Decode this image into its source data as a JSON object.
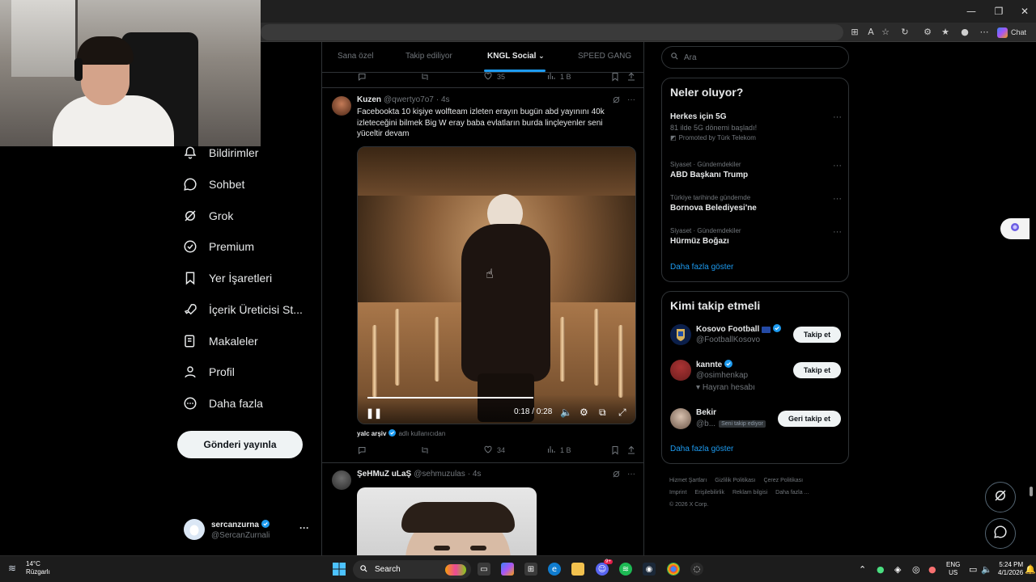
{
  "tabs": [
    {
      "label": "Sana özel"
    },
    {
      "label": "Takip ediliyor"
    },
    {
      "label": "KNGL Social"
    },
    {
      "label": "SPEED GANG"
    }
  ],
  "nav": {
    "items": [
      {
        "label": "Bildirimler",
        "icon": "bell-icon"
      },
      {
        "label": "Sohbet",
        "icon": "chat-icon"
      },
      {
        "label": "Grok",
        "icon": "grok-icon"
      },
      {
        "label": "Premium",
        "icon": "premium-icon"
      },
      {
        "label": "Yer İşaretleri",
        "icon": "bookmark-icon"
      },
      {
        "label": "İçerik Üreticisi St...",
        "icon": "rocket-icon"
      },
      {
        "label": "Makaleler",
        "icon": "article-icon"
      },
      {
        "label": "Profil",
        "icon": "person-icon"
      },
      {
        "label": "Daha fazla",
        "icon": "more-circle-icon"
      }
    ],
    "post_button": "Gönderi yayınla"
  },
  "account": {
    "name": "sercanzurna",
    "handle": "@SercanZurnali"
  },
  "top_actions": {
    "likes": "35",
    "views": "1 B"
  },
  "tweet1": {
    "name": "Kuzen",
    "handle": "@qwertyo7o7",
    "time": "· 4s",
    "text": "Facebookta 10 kişiye wolfteam izleten erayın bugün abd yayınını 40k izleteceğini bilmek Big W eray baba evlatların burda linçleyenler seni yüceltir devam",
    "video_time": "0:18 / 0:28",
    "video_progress": 0.64,
    "attribution_name": "yalc arşiv",
    "attribution_suffix": "adlı kullanıcıdan",
    "likes": "34",
    "views": "1 B"
  },
  "tweet2": {
    "name": "ŞeHMuZ uLaŞ",
    "handle": "@sehmuzulas",
    "time": "· 4s"
  },
  "search": {
    "placeholder": "Ara"
  },
  "trends": {
    "title": "Neler oluyor?",
    "items": [
      {
        "meta": "",
        "title": "Herkes için 5G",
        "sub": "81 ilde 5G dönemi başladı!",
        "promo": "Promoted by Türk Telekom"
      },
      {
        "meta": "Siyaset · Gündemdekiler",
        "title": "ABD Başkanı Trump"
      },
      {
        "meta": "Türkiye tarihinde gündemde",
        "title": "Bornova Belediyesi'ne"
      },
      {
        "meta": "Siyaset · Gündemdekiler",
        "title": "Hürmüz Boğazı"
      }
    ],
    "show_more": "Daha fazla göster"
  },
  "who": {
    "title": "Kimi takip etmeli",
    "items": [
      {
        "name": "Kosovo Football",
        "handle": "@FootballKosovo",
        "button": "Takip et"
      },
      {
        "name": "kannte",
        "handle": "@osimhenkap",
        "extra": "Hayran hesabı",
        "button": "Takip et"
      },
      {
        "name": "Bekir",
        "handle": "@b...",
        "badge": "Seni takip ediyor",
        "button": "Geri takip et"
      }
    ],
    "show_more": "Daha fazla göster"
  },
  "footer": {
    "links": [
      "Hizmet Şartları",
      "Gizlilik Politikası",
      "Çerez Politikası",
      "Imprint",
      "Erişilebilirlik",
      "Reklam bilgisi",
      "Daha fazla ..."
    ],
    "copyright": "© 2026 X Corp."
  },
  "browser": {
    "chat_label": "Chat"
  },
  "taskbar": {
    "temp": "14°C",
    "condition": "Rüzgarlı",
    "search": "Search",
    "lang_top": "ENG",
    "lang_bottom": "US",
    "time": "5:24 PM",
    "date": "4/1/2026",
    "notification_count": "9+"
  },
  "colors": {
    "accent": "#1d9bf0",
    "background": "#000000"
  }
}
